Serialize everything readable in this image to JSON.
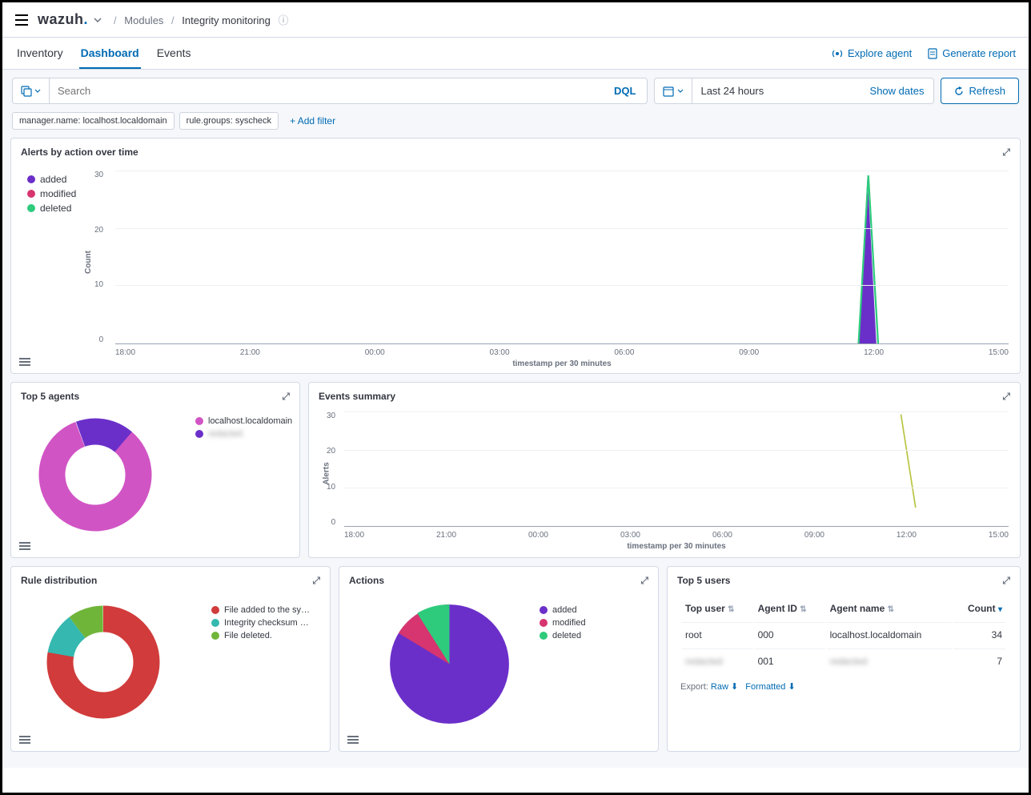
{
  "breadcrumb": {
    "modules": "Modules",
    "current": "Integrity monitoring"
  },
  "tabs": {
    "inventory": "Inventory",
    "dashboard": "Dashboard",
    "events": "Events"
  },
  "header_actions": {
    "explore": "Explore agent",
    "generate": "Generate report"
  },
  "search": {
    "placeholder": "Search",
    "dql": "DQL"
  },
  "datepicker": {
    "range": "Last 24 hours",
    "show": "Show dates",
    "refresh": "Refresh"
  },
  "filters": {
    "f1": "manager.name: localhost.localdomain",
    "f2": "rule.groups: syscheck",
    "add": "+ Add filter"
  },
  "panels": {
    "alerts": "Alerts by action over time",
    "agents": "Top 5 agents",
    "events": "Events summary",
    "rules": "Rule distribution",
    "actions": "Actions",
    "users": "Top 5 users"
  },
  "legend_actions": {
    "added": "added",
    "modified": "modified",
    "deleted": "deleted"
  },
  "axis": {
    "count": "Count",
    "alerts": "Alerts",
    "xlabel": "timestamp per 30 minutes",
    "xticks": [
      "18:00",
      "21:00",
      "00:00",
      "03:00",
      "06:00",
      "09:00",
      "12:00",
      "15:00"
    ],
    "yticks_alerts": [
      "0",
      "10",
      "20",
      "30"
    ],
    "yticks_events": [
      "0",
      "10",
      "20",
      "30"
    ]
  },
  "agents_legend": {
    "a1": "localhost.localdomain",
    "a2": "redacted"
  },
  "rules_legend": {
    "r1": "File added to the sy…",
    "r2": "Integrity checksum …",
    "r3": "File deleted."
  },
  "users_table": {
    "export_label": "Export:",
    "raw": "Raw",
    "formatted": "Formatted",
    "cols": {
      "user": "Top user",
      "agentid": "Agent ID",
      "agentname": "Agent name",
      "count": "Count"
    },
    "rows": [
      {
        "user": "root",
        "agentid": "000",
        "agentname": "localhost.localdomain",
        "count": "34"
      },
      {
        "user": "redacted",
        "agentid": "001",
        "agentname": "redacted",
        "count": "7"
      }
    ]
  },
  "chart_data": [
    {
      "type": "area",
      "title": "Alerts by action over time",
      "x": [
        "12:30",
        "12:45",
        "13:00"
      ],
      "xlabel": "timestamp per 30 minutes",
      "ylabel": "Count",
      "ylim": [
        0,
        35
      ],
      "series": [
        {
          "name": "added",
          "values": [
            0,
            34,
            0
          ],
          "color": "#6b2fc9"
        },
        {
          "name": "modified",
          "values": [
            0,
            0,
            0
          ],
          "color": "#d6356f"
        },
        {
          "name": "deleted",
          "values": [
            0,
            34,
            0
          ],
          "color": "#2ecb7d"
        }
      ]
    },
    {
      "type": "pie",
      "title": "Top 5 agents",
      "donut": true,
      "slices": [
        {
          "name": "localhost.localdomain",
          "value": 83,
          "color": "#d154c4"
        },
        {
          "name": "redacted",
          "value": 17,
          "color": "#6b2fc9"
        }
      ]
    },
    {
      "type": "line",
      "title": "Events summary",
      "x": [
        "12:30",
        "13:00"
      ],
      "xlabel": "timestamp per 30 minutes",
      "ylabel": "Alerts",
      "ylim": [
        0,
        35
      ],
      "series": [
        {
          "name": "alerts",
          "values": [
            34,
            6
          ],
          "color": "#b8c43f"
        }
      ]
    },
    {
      "type": "pie",
      "title": "Rule distribution",
      "donut": true,
      "slices": [
        {
          "name": "File added to the sy…",
          "value": 78,
          "color": "#d13b3b"
        },
        {
          "name": "Integrity checksum …",
          "value": 12,
          "color": "#34b8b0"
        },
        {
          "name": "File deleted.",
          "value": 10,
          "color": "#6fb53a"
        }
      ]
    },
    {
      "type": "pie",
      "title": "Actions",
      "donut": false,
      "slices": [
        {
          "name": "added",
          "value": 78,
          "color": "#6b2fc9"
        },
        {
          "name": "modified",
          "value": 12,
          "color": "#d6356f"
        },
        {
          "name": "deleted",
          "value": 10,
          "color": "#2ecb7d"
        }
      ]
    }
  ]
}
